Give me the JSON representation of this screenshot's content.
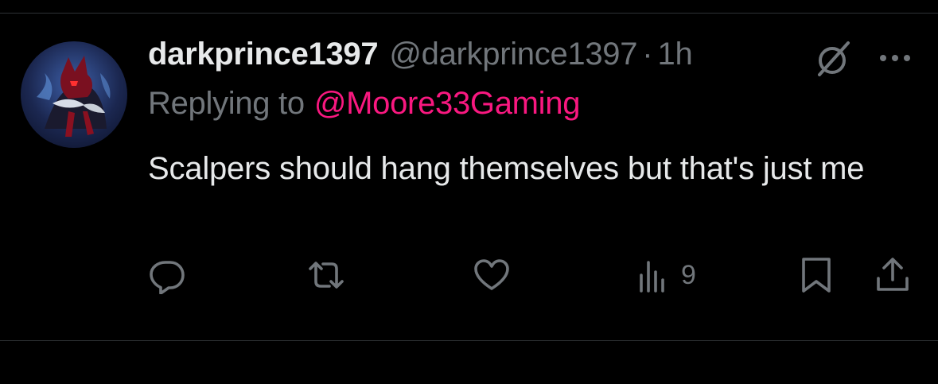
{
  "tweet": {
    "display_name": "darkprince1397",
    "handle": "@darkprince1397",
    "separator": "·",
    "time": "1h",
    "reply_prefix": "Replying to",
    "reply_to": "@Moore33Gaming",
    "text": "Scalpers should hang themselves but that's just me"
  },
  "actions": {
    "views_count": "9",
    "icons": [
      "reply-icon",
      "retweet-icon",
      "like-icon",
      "views-icon",
      "bookmark-icon",
      "share-icon"
    ]
  },
  "header_icons": [
    "grok-icon",
    "more-icon"
  ],
  "colors": {
    "background": "#000000",
    "primary_text": "#e7e9ea",
    "secondary_text": "#71767b",
    "mention": "#f91880",
    "divider": "#2f3336"
  }
}
